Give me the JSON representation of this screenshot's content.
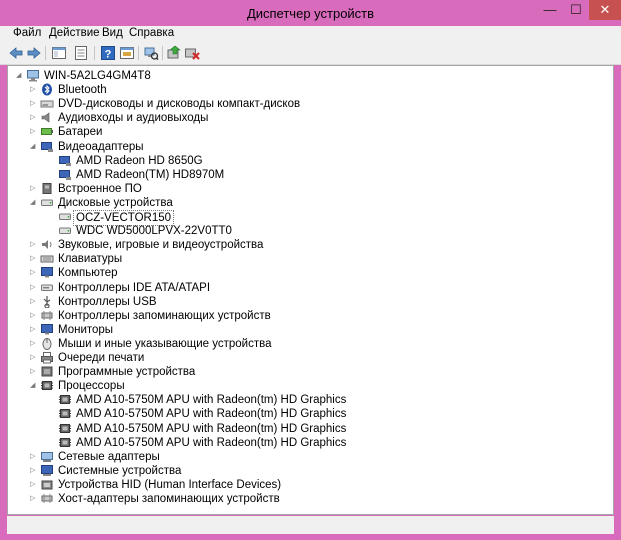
{
  "window": {
    "title": "Диспетчер устройств",
    "min_glyph": "—",
    "max_glyph": "☐",
    "close_glyph": "✕"
  },
  "menu": [
    "Файл",
    "Действие",
    "Вид",
    "Справка"
  ],
  "tree": [
    {
      "label": "WIN-5A2LG4GM4T8",
      "level": 0,
      "expanded": true,
      "icon": "computer-icon"
    },
    {
      "label": "Bluetooth",
      "level": 1,
      "expanded": false,
      "icon": "bluetooth-icon"
    },
    {
      "label": "DVD-дисководы и дисководы компакт-дисков",
      "level": 1,
      "expanded": false,
      "icon": "dvd-drive-icon"
    },
    {
      "label": "Аудиовходы и аудиовыходы",
      "level": 1,
      "expanded": false,
      "icon": "audio-icon"
    },
    {
      "label": "Батареи",
      "level": 1,
      "expanded": false,
      "icon": "battery-icon"
    },
    {
      "label": "Видеоадаптеры",
      "level": 1,
      "expanded": true,
      "icon": "display-adapter-icon"
    },
    {
      "label": "AMD Radeon HD 8650G",
      "level": 2,
      "icon": "display-adapter-icon"
    },
    {
      "label": "AMD Radeon(TM) HD8970M",
      "level": 2,
      "icon": "display-adapter-icon"
    },
    {
      "label": "Встроенное ПО",
      "level": 1,
      "expanded": false,
      "icon": "firmware-icon"
    },
    {
      "label": "Дисковые устройства",
      "level": 1,
      "expanded": true,
      "icon": "disk-drive-icon"
    },
    {
      "label": "OCZ-VECTOR150",
      "level": 2,
      "icon": "disk-drive-icon",
      "selected": true
    },
    {
      "label": "WDC WD5000LPVX-22V0TT0",
      "level": 2,
      "icon": "disk-drive-icon"
    },
    {
      "label": "Звуковые, игровые и видеоустройства",
      "level": 1,
      "expanded": false,
      "icon": "speaker-icon"
    },
    {
      "label": "Клавиатуры",
      "level": 1,
      "expanded": false,
      "icon": "keyboard-icon"
    },
    {
      "label": "Компьютер",
      "level": 1,
      "expanded": false,
      "icon": "monitor-icon"
    },
    {
      "label": "Контроллеры IDE ATA/ATAPI",
      "level": 1,
      "expanded": false,
      "icon": "ide-controller-icon"
    },
    {
      "label": "Контроллеры USB",
      "level": 1,
      "expanded": false,
      "icon": "usb-icon"
    },
    {
      "label": "Контроллеры запоминающих устройств",
      "level": 1,
      "expanded": false,
      "icon": "storage-controller-icon"
    },
    {
      "label": "Мониторы",
      "level": 1,
      "expanded": false,
      "icon": "monitor-icon"
    },
    {
      "label": "Мыши и иные указывающие устройства",
      "level": 1,
      "expanded": false,
      "icon": "mouse-icon"
    },
    {
      "label": "Очереди печати",
      "level": 1,
      "expanded": false,
      "icon": "printer-icon"
    },
    {
      "label": "Программные устройства",
      "level": 1,
      "expanded": false,
      "icon": "software-device-icon"
    },
    {
      "label": "Процессоры",
      "level": 1,
      "expanded": true,
      "icon": "processor-icon"
    },
    {
      "label": "AMD A10-5750M APU with Radeon(tm) HD Graphics",
      "level": 2,
      "icon": "processor-icon"
    },
    {
      "label": "AMD A10-5750M APU with Radeon(tm) HD Graphics",
      "level": 2,
      "icon": "processor-icon"
    },
    {
      "label": "AMD A10-5750M APU with Radeon(tm) HD Graphics",
      "level": 2,
      "icon": "processor-icon"
    },
    {
      "label": "AMD A10-5750M APU with Radeon(tm) HD Graphics",
      "level": 2,
      "icon": "processor-icon"
    },
    {
      "label": "Сетевые адаптеры",
      "level": 1,
      "expanded": false,
      "icon": "network-adapter-icon"
    },
    {
      "label": "Системные устройства",
      "level": 1,
      "expanded": false,
      "icon": "system-device-icon"
    },
    {
      "label": "Устройства HID (Human Interface Devices)",
      "level": 1,
      "expanded": false,
      "icon": "hid-icon"
    },
    {
      "label": "Хост-адаптеры запоминающих устройств",
      "level": 1,
      "expanded": false,
      "icon": "storage-controller-icon"
    }
  ],
  "colors": {
    "window_frame": "#d96bbd",
    "close_button": "#c75050",
    "selection_border": "#7a7a7a"
  }
}
